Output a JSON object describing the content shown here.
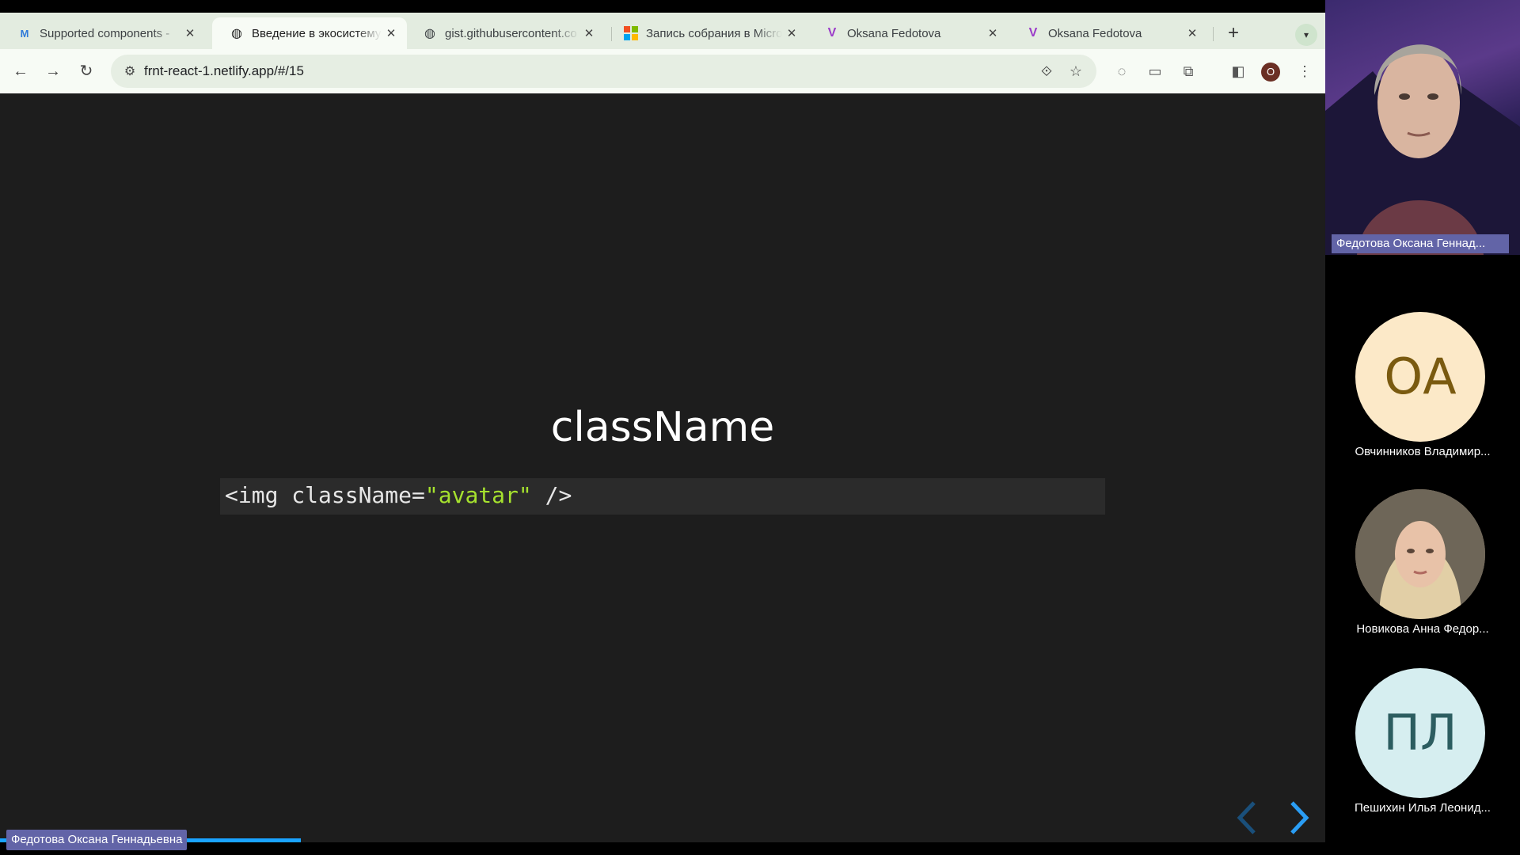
{
  "browser": {
    "tabs": [
      {
        "label": "Supported components -",
        "favicon": "mui-icon",
        "active": false
      },
      {
        "label": "Введение в экосистему",
        "favicon": "globe-icon",
        "active": true
      },
      {
        "label": "gist.githubusercontent.co",
        "favicon": "globe-icon",
        "active": false
      },
      {
        "label": "Запись собрания в Micro",
        "favicon": "microsoft-icon",
        "active": false
      },
      {
        "label": "Oksana Fedotova",
        "favicon": "v-logo-icon",
        "active": false
      },
      {
        "label": "Oksana Fedotova",
        "favicon": "v-logo-icon",
        "active": false
      }
    ],
    "tab_close_glyph": "✕",
    "new_tab_glyph": "+",
    "url": "frnt-react-1.netlify.app/#/15",
    "profile_initial": "O"
  },
  "slide": {
    "title": "className",
    "code_prefix": "<img className=",
    "code_string": "\"avatar\"",
    "code_suffix": " />"
  },
  "meeting": {
    "presenter_name": "Федотова Оксана Геннадьевна",
    "video_name": "Федотова Оксана Геннад...",
    "participants": [
      {
        "initials": "ОА",
        "name": "Овчинников Владимир...",
        "bg": "#fce9c8",
        "fg": "#7a5a10"
      },
      {
        "initials": "",
        "name": "Новикова Анна Федор...",
        "bg": "#b8a48c",
        "fg": "#000"
      },
      {
        "initials": "ПЛ",
        "name": "Пешихин Илья Леонид...",
        "bg": "#d6eef0",
        "fg": "#2c5d60"
      }
    ]
  },
  "colors": {
    "accent_blue": "#1aa3ff",
    "teams_purple": "#6264a7",
    "code_string": "#a6e22e"
  }
}
